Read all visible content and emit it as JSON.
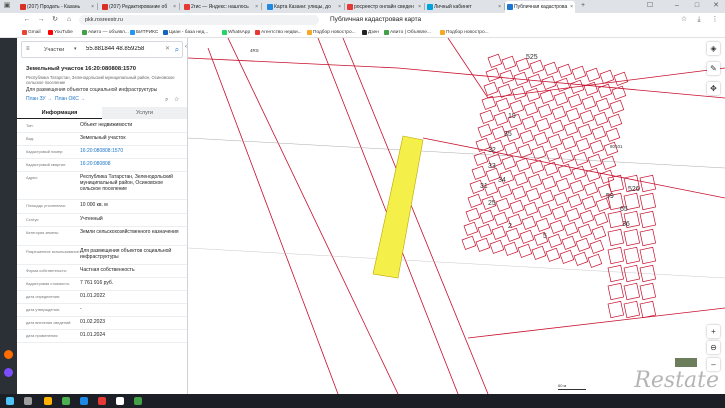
{
  "browser": {
    "tabs": [
      {
        "label": "(207) Продать - Казань",
        "color": "#d93025"
      },
      {
        "label": "(207) Редактирование об",
        "color": "#d93025"
      },
      {
        "label": "2гис — Яндекс: нашлось",
        "color": "#e53935"
      },
      {
        "label": "Карта Казани: улицы, до",
        "color": "#1e88e5"
      },
      {
        "label": "росреестр онлайн сведен",
        "color": "#e53935"
      },
      {
        "label": "Личный кабинет",
        "color": "#00a3e0"
      },
      {
        "label": "Публичная кадастрова",
        "color": "#1976d2"
      }
    ],
    "address": "pkk.rosreestr.ru",
    "page_title": "Публичная кадастровая карта"
  },
  "bookmarks": [
    {
      "label": "Gmail",
      "color": "#ea4335"
    },
    {
      "label": "YouTube",
      "color": "#ff0000"
    },
    {
      "label": "Авито — объявл...",
      "color": "#43a047"
    },
    {
      "label": "БИТРИКС",
      "color": "#2196f3"
    },
    {
      "label": "Циан - база нед...",
      "color": "#1565c0"
    },
    {
      "label": "WhatsApp",
      "color": "#25d366"
    },
    {
      "label": "Агентство недви...",
      "color": "#e53935"
    },
    {
      "label": "Подбор новостро...",
      "color": "#f9a825"
    },
    {
      "label": "Дзен",
      "color": "#222222"
    },
    {
      "label": "Авито | Объявле...",
      "color": "#43a047"
    },
    {
      "label": "Подбор новостро...",
      "color": "#f9a825"
    }
  ],
  "search": {
    "type_label": "Участки",
    "value": "55.881844 48.859258"
  },
  "object": {
    "title": "Земельный участок 16:20:080808:1570",
    "address": "Республика Татарстан, Зеленодольский муниципальный район, Осиновское сельское поселение",
    "use": "Для размещения объектов социальной инфраструктуры",
    "plan_zu": "План ЗУ →",
    "plan_oks": "План ОКС →"
  },
  "tabs": {
    "info": "Информация",
    "services": "Услуги"
  },
  "rows": [
    {
      "k": "Тип:",
      "v": "Объект недвижимости",
      "link": false
    },
    {
      "k": "Вид:",
      "v": "Земельный участок",
      "link": false
    },
    {
      "k": "Кадастровый номер:",
      "v": "16:20:080808:1570",
      "link": true
    },
    {
      "k": "Кадастровый квартал:",
      "v": "16:20:080808",
      "link": true
    },
    {
      "k": "Адрес:",
      "v": "Республика Татарстан, Зеленодольский муниципальный район, Осиновское сельское поселение",
      "link": false
    },
    {
      "k": "Площадь уточненная:",
      "v": "10 000 кв. м",
      "link": false
    },
    {
      "k": "Статус:",
      "v": "Учтенный",
      "link": false
    },
    {
      "k": "Категория земель:",
      "v": "Земли сельскохозяйственного назначения",
      "link": false
    },
    {
      "k": "Разрешенное использование:",
      "v": "Для размещения объектов социальной инфраструктуры",
      "link": false
    },
    {
      "k": "Форма собственности:",
      "v": "Частная собственность",
      "link": false
    },
    {
      "k": "Кадастровая стоимость:",
      "v": "7 761 916 руб.",
      "link": false
    },
    {
      "k": "дата определения:",
      "v": "01.01.2022",
      "link": false
    },
    {
      "k": "дата утверждения:",
      "v": "-",
      "link": false
    },
    {
      "k": "дата внесения сведений:",
      "v": "01.02.2023",
      "link": false
    },
    {
      "k": "дата применения:",
      "v": "01.01.2024",
      "link": false
    }
  ],
  "map": {
    "labels": [
      "80101",
      "4RS",
      "525",
      "526",
      "59",
      "65",
      "36",
      "32",
      "33",
      "34",
      "35",
      "19",
      "31",
      "25",
      "2",
      "5"
    ],
    "scale": "60 м",
    "parcel_color": "#f5ef4a",
    "line_color": "#c8102e"
  },
  "watermark": "Restate"
}
